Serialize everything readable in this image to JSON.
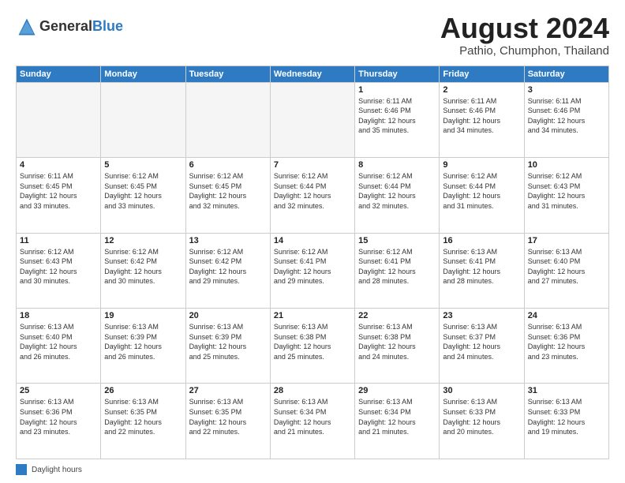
{
  "header": {
    "logo_general": "General",
    "logo_blue": "Blue",
    "month_title": "August 2024",
    "subtitle": "Pathio, Chumphon, Thailand"
  },
  "footer": {
    "legend_label": "Daylight hours"
  },
  "days_of_week": [
    "Sunday",
    "Monday",
    "Tuesday",
    "Wednesday",
    "Thursday",
    "Friday",
    "Saturday"
  ],
  "weeks": [
    [
      {
        "day": "",
        "info": ""
      },
      {
        "day": "",
        "info": ""
      },
      {
        "day": "",
        "info": ""
      },
      {
        "day": "",
        "info": ""
      },
      {
        "day": "1",
        "info": "Sunrise: 6:11 AM\nSunset: 6:46 PM\nDaylight: 12 hours\nand 35 minutes."
      },
      {
        "day": "2",
        "info": "Sunrise: 6:11 AM\nSunset: 6:46 PM\nDaylight: 12 hours\nand 34 minutes."
      },
      {
        "day": "3",
        "info": "Sunrise: 6:11 AM\nSunset: 6:46 PM\nDaylight: 12 hours\nand 34 minutes."
      }
    ],
    [
      {
        "day": "4",
        "info": "Sunrise: 6:11 AM\nSunset: 6:45 PM\nDaylight: 12 hours\nand 33 minutes."
      },
      {
        "day": "5",
        "info": "Sunrise: 6:12 AM\nSunset: 6:45 PM\nDaylight: 12 hours\nand 33 minutes."
      },
      {
        "day": "6",
        "info": "Sunrise: 6:12 AM\nSunset: 6:45 PM\nDaylight: 12 hours\nand 32 minutes."
      },
      {
        "day": "7",
        "info": "Sunrise: 6:12 AM\nSunset: 6:44 PM\nDaylight: 12 hours\nand 32 minutes."
      },
      {
        "day": "8",
        "info": "Sunrise: 6:12 AM\nSunset: 6:44 PM\nDaylight: 12 hours\nand 32 minutes."
      },
      {
        "day": "9",
        "info": "Sunrise: 6:12 AM\nSunset: 6:44 PM\nDaylight: 12 hours\nand 31 minutes."
      },
      {
        "day": "10",
        "info": "Sunrise: 6:12 AM\nSunset: 6:43 PM\nDaylight: 12 hours\nand 31 minutes."
      }
    ],
    [
      {
        "day": "11",
        "info": "Sunrise: 6:12 AM\nSunset: 6:43 PM\nDaylight: 12 hours\nand 30 minutes."
      },
      {
        "day": "12",
        "info": "Sunrise: 6:12 AM\nSunset: 6:42 PM\nDaylight: 12 hours\nand 30 minutes."
      },
      {
        "day": "13",
        "info": "Sunrise: 6:12 AM\nSunset: 6:42 PM\nDaylight: 12 hours\nand 29 minutes."
      },
      {
        "day": "14",
        "info": "Sunrise: 6:12 AM\nSunset: 6:41 PM\nDaylight: 12 hours\nand 29 minutes."
      },
      {
        "day": "15",
        "info": "Sunrise: 6:12 AM\nSunset: 6:41 PM\nDaylight: 12 hours\nand 28 minutes."
      },
      {
        "day": "16",
        "info": "Sunrise: 6:13 AM\nSunset: 6:41 PM\nDaylight: 12 hours\nand 28 minutes."
      },
      {
        "day": "17",
        "info": "Sunrise: 6:13 AM\nSunset: 6:40 PM\nDaylight: 12 hours\nand 27 minutes."
      }
    ],
    [
      {
        "day": "18",
        "info": "Sunrise: 6:13 AM\nSunset: 6:40 PM\nDaylight: 12 hours\nand 26 minutes."
      },
      {
        "day": "19",
        "info": "Sunrise: 6:13 AM\nSunset: 6:39 PM\nDaylight: 12 hours\nand 26 minutes."
      },
      {
        "day": "20",
        "info": "Sunrise: 6:13 AM\nSunset: 6:39 PM\nDaylight: 12 hours\nand 25 minutes."
      },
      {
        "day": "21",
        "info": "Sunrise: 6:13 AM\nSunset: 6:38 PM\nDaylight: 12 hours\nand 25 minutes."
      },
      {
        "day": "22",
        "info": "Sunrise: 6:13 AM\nSunset: 6:38 PM\nDaylight: 12 hours\nand 24 minutes."
      },
      {
        "day": "23",
        "info": "Sunrise: 6:13 AM\nSunset: 6:37 PM\nDaylight: 12 hours\nand 24 minutes."
      },
      {
        "day": "24",
        "info": "Sunrise: 6:13 AM\nSunset: 6:36 PM\nDaylight: 12 hours\nand 23 minutes."
      }
    ],
    [
      {
        "day": "25",
        "info": "Sunrise: 6:13 AM\nSunset: 6:36 PM\nDaylight: 12 hours\nand 23 minutes."
      },
      {
        "day": "26",
        "info": "Sunrise: 6:13 AM\nSunset: 6:35 PM\nDaylight: 12 hours\nand 22 minutes."
      },
      {
        "day": "27",
        "info": "Sunrise: 6:13 AM\nSunset: 6:35 PM\nDaylight: 12 hours\nand 22 minutes."
      },
      {
        "day": "28",
        "info": "Sunrise: 6:13 AM\nSunset: 6:34 PM\nDaylight: 12 hours\nand 21 minutes."
      },
      {
        "day": "29",
        "info": "Sunrise: 6:13 AM\nSunset: 6:34 PM\nDaylight: 12 hours\nand 21 minutes."
      },
      {
        "day": "30",
        "info": "Sunrise: 6:13 AM\nSunset: 6:33 PM\nDaylight: 12 hours\nand 20 minutes."
      },
      {
        "day": "31",
        "info": "Sunrise: 6:13 AM\nSunset: 6:33 PM\nDaylight: 12 hours\nand 19 minutes."
      }
    ]
  ]
}
